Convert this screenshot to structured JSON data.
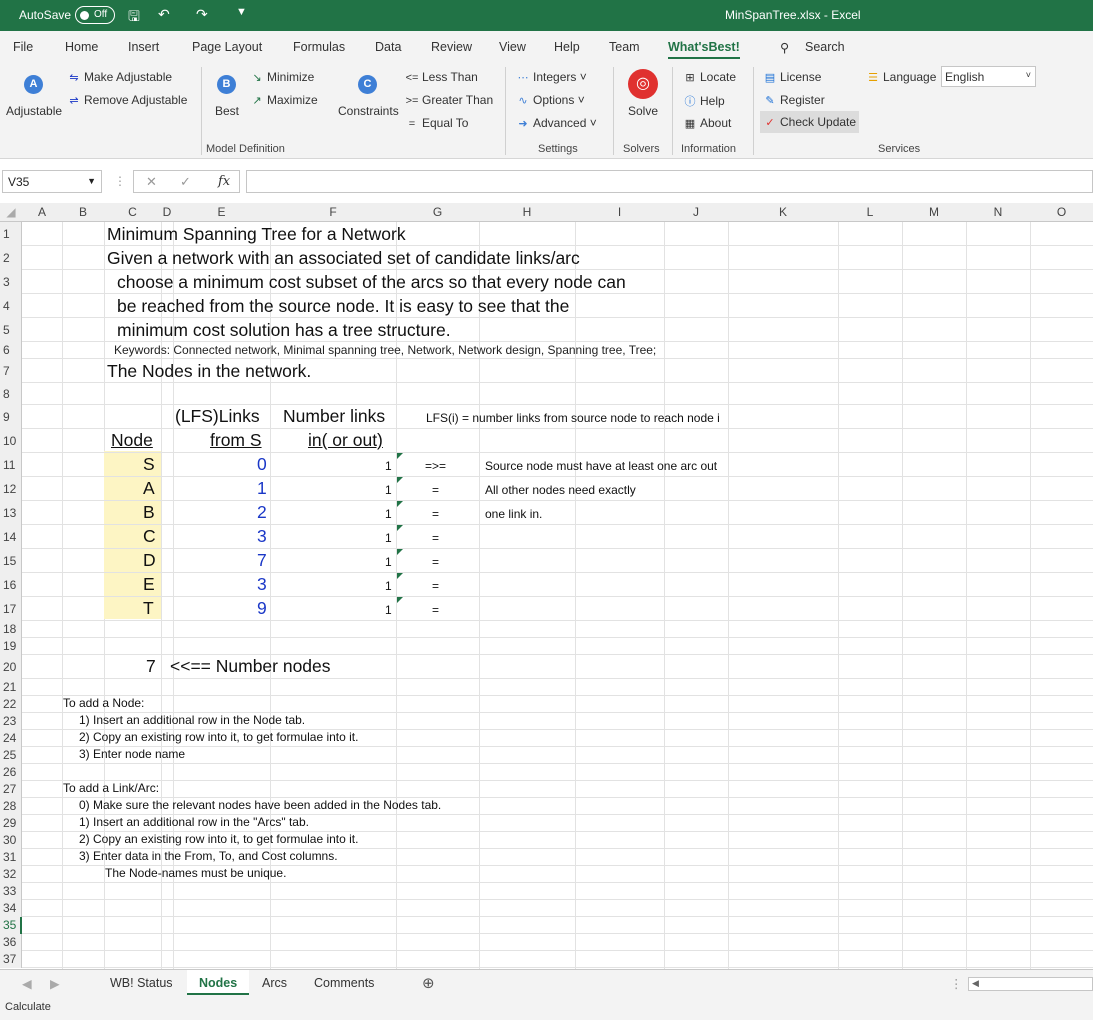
{
  "titlebar": {
    "autosave_label": "AutoSave",
    "toggle_label": "Off",
    "title": "MinSpanTree.xlsx  -  Excel"
  },
  "tabs": [
    "File",
    "Home",
    "Insert",
    "Page Layout",
    "Formulas",
    "Data",
    "Review",
    "View",
    "Help",
    "Team",
    "What'sBest!",
    "Search"
  ],
  "ribbon": {
    "adjustable": "Adjustable",
    "make_adjustable": "Make Adjustable",
    "remove_adjustable": "Remove Adjustable",
    "best": "Best",
    "minimize": "Minimize",
    "maximize": "Maximize",
    "constraints": "Constraints",
    "less_than": "Less Than",
    "greater_than": "Greater Than",
    "equal_to": "Equal To",
    "integers": "Integers",
    "options": "Options",
    "advanced": "Advanced",
    "solve": "Solve",
    "locate": "Locate",
    "help": "Help",
    "about": "About",
    "license": "License",
    "register": "Register",
    "check_update": "Check Update",
    "language_label": "Language",
    "language_value": "English",
    "groups": {
      "model_definition": "Model Definition",
      "settings": "Settings",
      "solvers": "Solvers",
      "information": "Information",
      "services": "Services"
    }
  },
  "formula_bar": {
    "name_box": "V35",
    "fx": "fx",
    "formula": ""
  },
  "columns": [
    "A",
    "B",
    "C",
    "D",
    "E",
    "F",
    "G",
    "H",
    "I",
    "J",
    "K",
    "L",
    "M",
    "N",
    "O"
  ],
  "rows": [
    "1",
    "2",
    "3",
    "4",
    "5",
    "6",
    "7",
    "8",
    "9",
    "10",
    "11",
    "12",
    "13",
    "14",
    "15",
    "16",
    "17",
    "18",
    "19",
    "20",
    "21",
    "22",
    "23",
    "24",
    "25",
    "26",
    "27",
    "28",
    "29",
    "30",
    "31",
    "32",
    "33",
    "34",
    "35",
    "36",
    "37"
  ],
  "sheet": {
    "title": "Minimum Spanning Tree for a Network",
    "desc1": "Given a network with an associated set of candidate links/arc",
    "desc2": "choose  a minimum cost subset of the arcs so that every node can",
    "desc3": "be reached from the source node. It is easy to see that the",
    "desc4": "minimum cost solution has a tree structure.",
    "keywords": "Keywords: Connected network, Minimal spanning tree, Network, Network design, Spanning tree, Tree;",
    "nodes_heading": "The Nodes in the network.",
    "hdr_lfs1": "(LFS)Links",
    "hdr_lfs2": "from S",
    "hdr_num1": "Number links",
    "hdr_num2": "in( or out)",
    "hdr_node": "Node",
    "lfs_note": "LFS(i) = number links from source node to reach node i",
    "nodes": [
      {
        "name": "S",
        "lfs": "0",
        "links": "1",
        "rel": "=>="
      },
      {
        "name": "A",
        "lfs": "1",
        "links": "1",
        "rel": "="
      },
      {
        "name": "B",
        "lfs": "2",
        "links": "1",
        "rel": "="
      },
      {
        "name": "C",
        "lfs": "3",
        "links": "1",
        "rel": "="
      },
      {
        "name": "D",
        "lfs": "7",
        "links": "1",
        "rel": "="
      },
      {
        "name": "E",
        "lfs": "3",
        "links": "1",
        "rel": "="
      },
      {
        "name": "T",
        "lfs": "9",
        "links": "1",
        "rel": "="
      }
    ],
    "note1": "Source node must have at least one arc out",
    "note2": "All other nodes need exactly",
    "note3": "one link in.",
    "num_nodes": "7",
    "num_nodes_label": "<<== Number nodes",
    "add_node": [
      "To add a Node:",
      "1) Insert an additional row in the Node tab.",
      "2) Copy an existing row into it, to get formulae into it.",
      "3)  Enter node name"
    ],
    "add_link": [
      "To add a Link/Arc:",
      "0)  Make sure the relevant nodes have been added in the Nodes tab.",
      "1) Insert an additional row in the \"Arcs\" tab.",
      "2) Copy an existing row into it, to get formulae into it.",
      "3) Enter data in the From, To, and Cost columns.",
      "The Node-names must be unique."
    ]
  },
  "sheet_tabs": [
    "WB! Status",
    "Nodes",
    "Arcs",
    "Comments"
  ],
  "status": "Calculate"
}
